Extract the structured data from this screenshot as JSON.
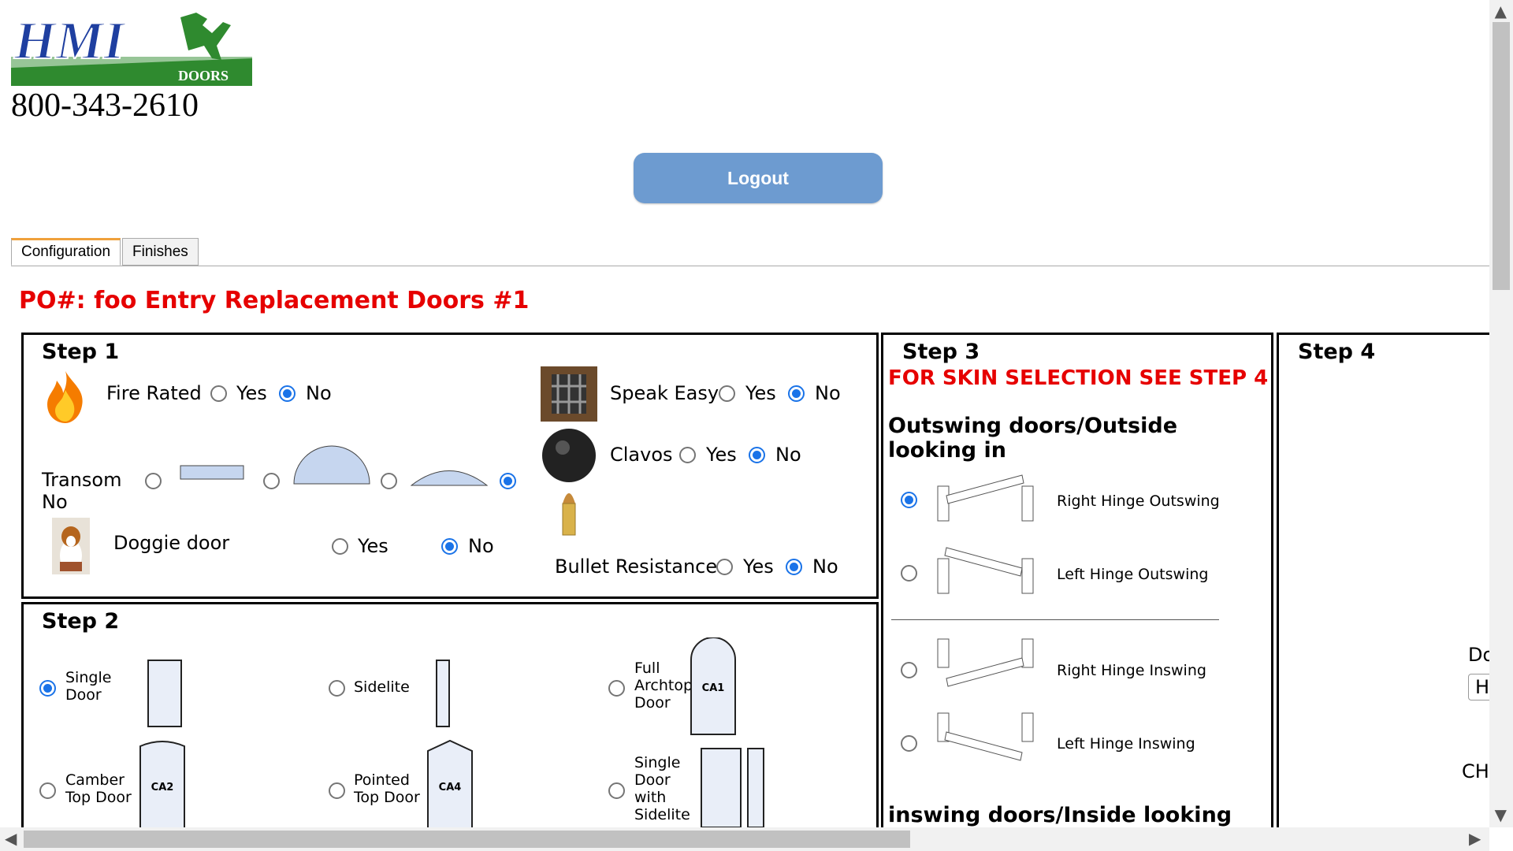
{
  "brand": {
    "logo_text": "HMI",
    "logo_sub": "DOORS",
    "phone": "800-343-2610"
  },
  "logout_label": "Logout",
  "tabs": [
    {
      "label": "Configuration",
      "active": true
    },
    {
      "label": "Finishes",
      "active": false
    }
  ],
  "po_title": "PO#: foo Entry Replacement Doors #1",
  "step1": {
    "title": "Step 1",
    "fire_rated": {
      "label": "Fire Rated",
      "yes": "Yes",
      "no": "No",
      "selected": "No"
    },
    "speak_easy": {
      "label": "Speak Easy",
      "yes": "Yes",
      "no": "No",
      "selected": "No"
    },
    "clavos": {
      "label": "Clavos",
      "yes": "Yes",
      "no": "No",
      "selected": "No"
    },
    "transom": {
      "label": "Transom",
      "sub": "No",
      "selected_index": 3
    },
    "doggie_door": {
      "label": "Doggie door",
      "yes": "Yes",
      "no": "No",
      "selected": "No"
    },
    "bullet_resistance": {
      "label": "Bullet Resistance",
      "yes": "Yes",
      "no": "No",
      "selected": "No"
    }
  },
  "step2": {
    "title": "Step 2",
    "options": [
      {
        "label": "Single Door",
        "selected": true
      },
      {
        "label": "Sidelite",
        "selected": false
      },
      {
        "label": "Full Archtop Door",
        "code": "CA1",
        "selected": false
      },
      {
        "label": "Camber Top Door",
        "code": "CA2",
        "selected": false
      },
      {
        "label": "Pointed Top Door",
        "code": "CA4",
        "selected": false
      },
      {
        "label": "Single Door with Sidelite",
        "selected": false
      }
    ]
  },
  "step3": {
    "title": "Step 3",
    "note": "FOR SKIN SELECTION SEE STEP 4",
    "outswing_heading": "Outswing doors/Outside looking in",
    "inswing_heading": "inswing doors/Inside looking out",
    "options": [
      {
        "label": "Right Hinge Outswing",
        "selected": true
      },
      {
        "label": "Left Hinge Outswing",
        "selected": false
      },
      {
        "label": "Right Hinge Inswing",
        "selected": false
      },
      {
        "label": "Left Hinge Inswing",
        "selected": false
      }
    ]
  },
  "step4": {
    "title": "Step 4",
    "partial_label": "Do",
    "partial_input": "H",
    "partial_choice": "CH"
  },
  "colors": {
    "accent_red": "#e60000",
    "button_blue": "#6d9bd0",
    "radio_blue": "#1a73e8"
  }
}
